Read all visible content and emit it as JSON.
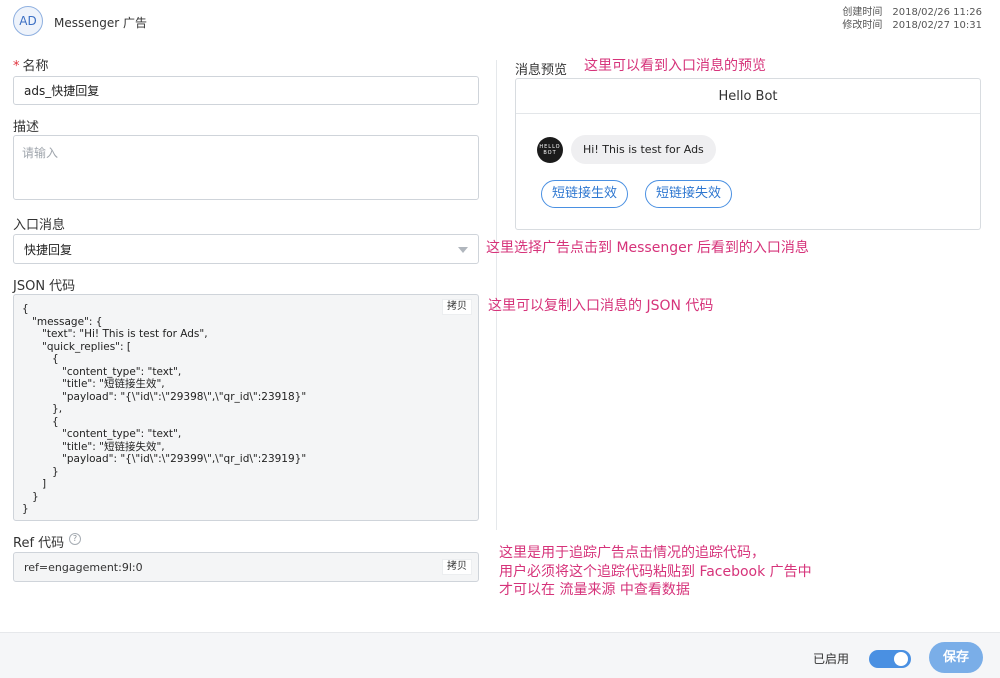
{
  "header": {
    "avatar_text": "AD",
    "title": "Messenger 广告",
    "created_label": "创建时间",
    "created_value": "2018/02/26 11:26",
    "modified_label": "修改时间",
    "modified_value": "2018/02/27 10:31"
  },
  "form": {
    "name_required": "*",
    "name_label": "名称",
    "name_value": "ads_快捷回复",
    "desc_label": "描述",
    "desc_placeholder": "请输入",
    "entry_label": "入口消息",
    "entry_value": "快捷回复",
    "json_label": "JSON 代码",
    "json_code": "{\n   \"message\": {\n      \"text\": \"Hi! This is test for Ads\",\n      \"quick_replies\": [\n         {\n            \"content_type\": \"text\",\n            \"title\": \"短链接生效\",\n            \"payload\": \"{\\\"id\\\":\\\"29398\\\",\\\"qr_id\\\":23918}\"\n         },\n         {\n            \"content_type\": \"text\",\n            \"title\": \"短链接失效\",\n            \"payload\": \"{\\\"id\\\":\\\"29399\\\",\\\"qr_id\\\":23919}\"\n         }\n      ]\n   }\n}",
    "copy_label": "拷贝",
    "ref_label": "Ref 代码",
    "ref_value": "ref=engagement:9l:0",
    "help_glyph": "?"
  },
  "preview": {
    "label": "消息预览",
    "bot_name": "Hello Bot",
    "bot_avatar_line1": "HELLO",
    "bot_avatar_line2": "BOT",
    "message": "Hi! This is test for Ads",
    "quick_replies": [
      "短链接生效",
      "短链接失效"
    ]
  },
  "annotations": {
    "preview": "这里可以看到入口消息的预览",
    "entry": "这里选择广告点击到 Messenger 后看到的入口消息",
    "json": "这里可以复制入口消息的 JSON 代码",
    "ref_line1": "这里是用于追踪广告点击情况的追踪代码，",
    "ref_line2": "用户必须将这个追踪代码粘贴到 Facebook 广告中",
    "ref_line3": "才可以在 流量来源 中查看数据"
  },
  "footer": {
    "enabled_label": "已启用",
    "toggle_on": true,
    "save_label": "保存"
  },
  "colors": {
    "accent": "#4a90e2",
    "annotation": "#d6337a",
    "required": "#e0313c"
  }
}
